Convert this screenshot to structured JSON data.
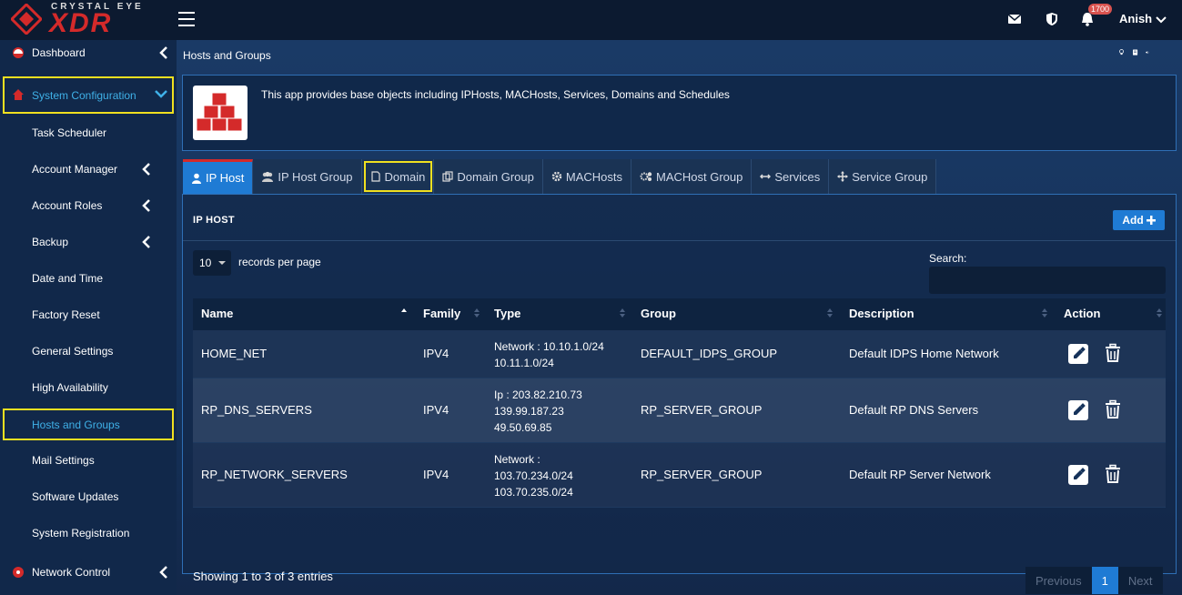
{
  "brand": {
    "top": "CRYSTAL EYE",
    "main": "XDR"
  },
  "header": {
    "notifications_count": "1700",
    "user": "Anish"
  },
  "sidebar": {
    "dashboard": "Dashboard",
    "system_configuration": "System Configuration",
    "items": [
      {
        "label": "Task Scheduler"
      },
      {
        "label": "Account Manager"
      },
      {
        "label": "Account Roles"
      },
      {
        "label": "Backup"
      },
      {
        "label": "Date and Time"
      },
      {
        "label": "Factory Reset"
      },
      {
        "label": "General Settings"
      },
      {
        "label": "High Availability"
      },
      {
        "label": "Hosts and Groups"
      },
      {
        "label": "Mail Settings"
      },
      {
        "label": "Software Updates"
      },
      {
        "label": "System Registration"
      }
    ],
    "network_control": "Network Control"
  },
  "page": {
    "title": "Hosts and Groups",
    "info": "This app provides base objects including IPHosts, MACHosts, Services, Domains and Schedules"
  },
  "tabs": [
    {
      "label": "IP Host"
    },
    {
      "label": "IP Host Group"
    },
    {
      "label": "Domain"
    },
    {
      "label": "Domain Group"
    },
    {
      "label": "MACHosts"
    },
    {
      "label": "MACHost Group"
    },
    {
      "label": "Services"
    },
    {
      "label": "Service Group"
    }
  ],
  "panel": {
    "title": "IP HOST",
    "add_label": "Add",
    "length_value": "10",
    "length_label": "records per page",
    "search_label": "Search:",
    "search_value": ""
  },
  "table": {
    "headers": [
      "Name",
      "Family",
      "Type",
      "Group",
      "Description",
      "Action"
    ],
    "rows": [
      {
        "name": "HOME_NET",
        "family": "IPV4",
        "type": [
          "Network : 10.10.1.0/24",
          "10.11.1.0/24"
        ],
        "group": "DEFAULT_IDPS_GROUP",
        "description": "Default IDPS Home Network"
      },
      {
        "name": "RP_DNS_SERVERS",
        "family": "IPV4",
        "type": [
          "Ip : 203.82.210.73",
          "139.99.187.23",
          "49.50.69.85"
        ],
        "group": "RP_SERVER_GROUP",
        "description": "Default RP DNS Servers"
      },
      {
        "name": "RP_NETWORK_SERVERS",
        "family": "IPV4",
        "type": [
          "Network :",
          "103.70.234.0/24",
          "103.70.235.0/24"
        ],
        "group": "RP_SERVER_GROUP",
        "description": "Default RP Server Network"
      }
    ]
  },
  "footer": {
    "info": "Showing 1 to 3 of 3 entries",
    "previous": "Previous",
    "page": "1",
    "next": "Next"
  },
  "colors": {
    "accent": "#1f7bd4",
    "brand_red": "#d42a2a",
    "highlight": "#f0e020"
  }
}
